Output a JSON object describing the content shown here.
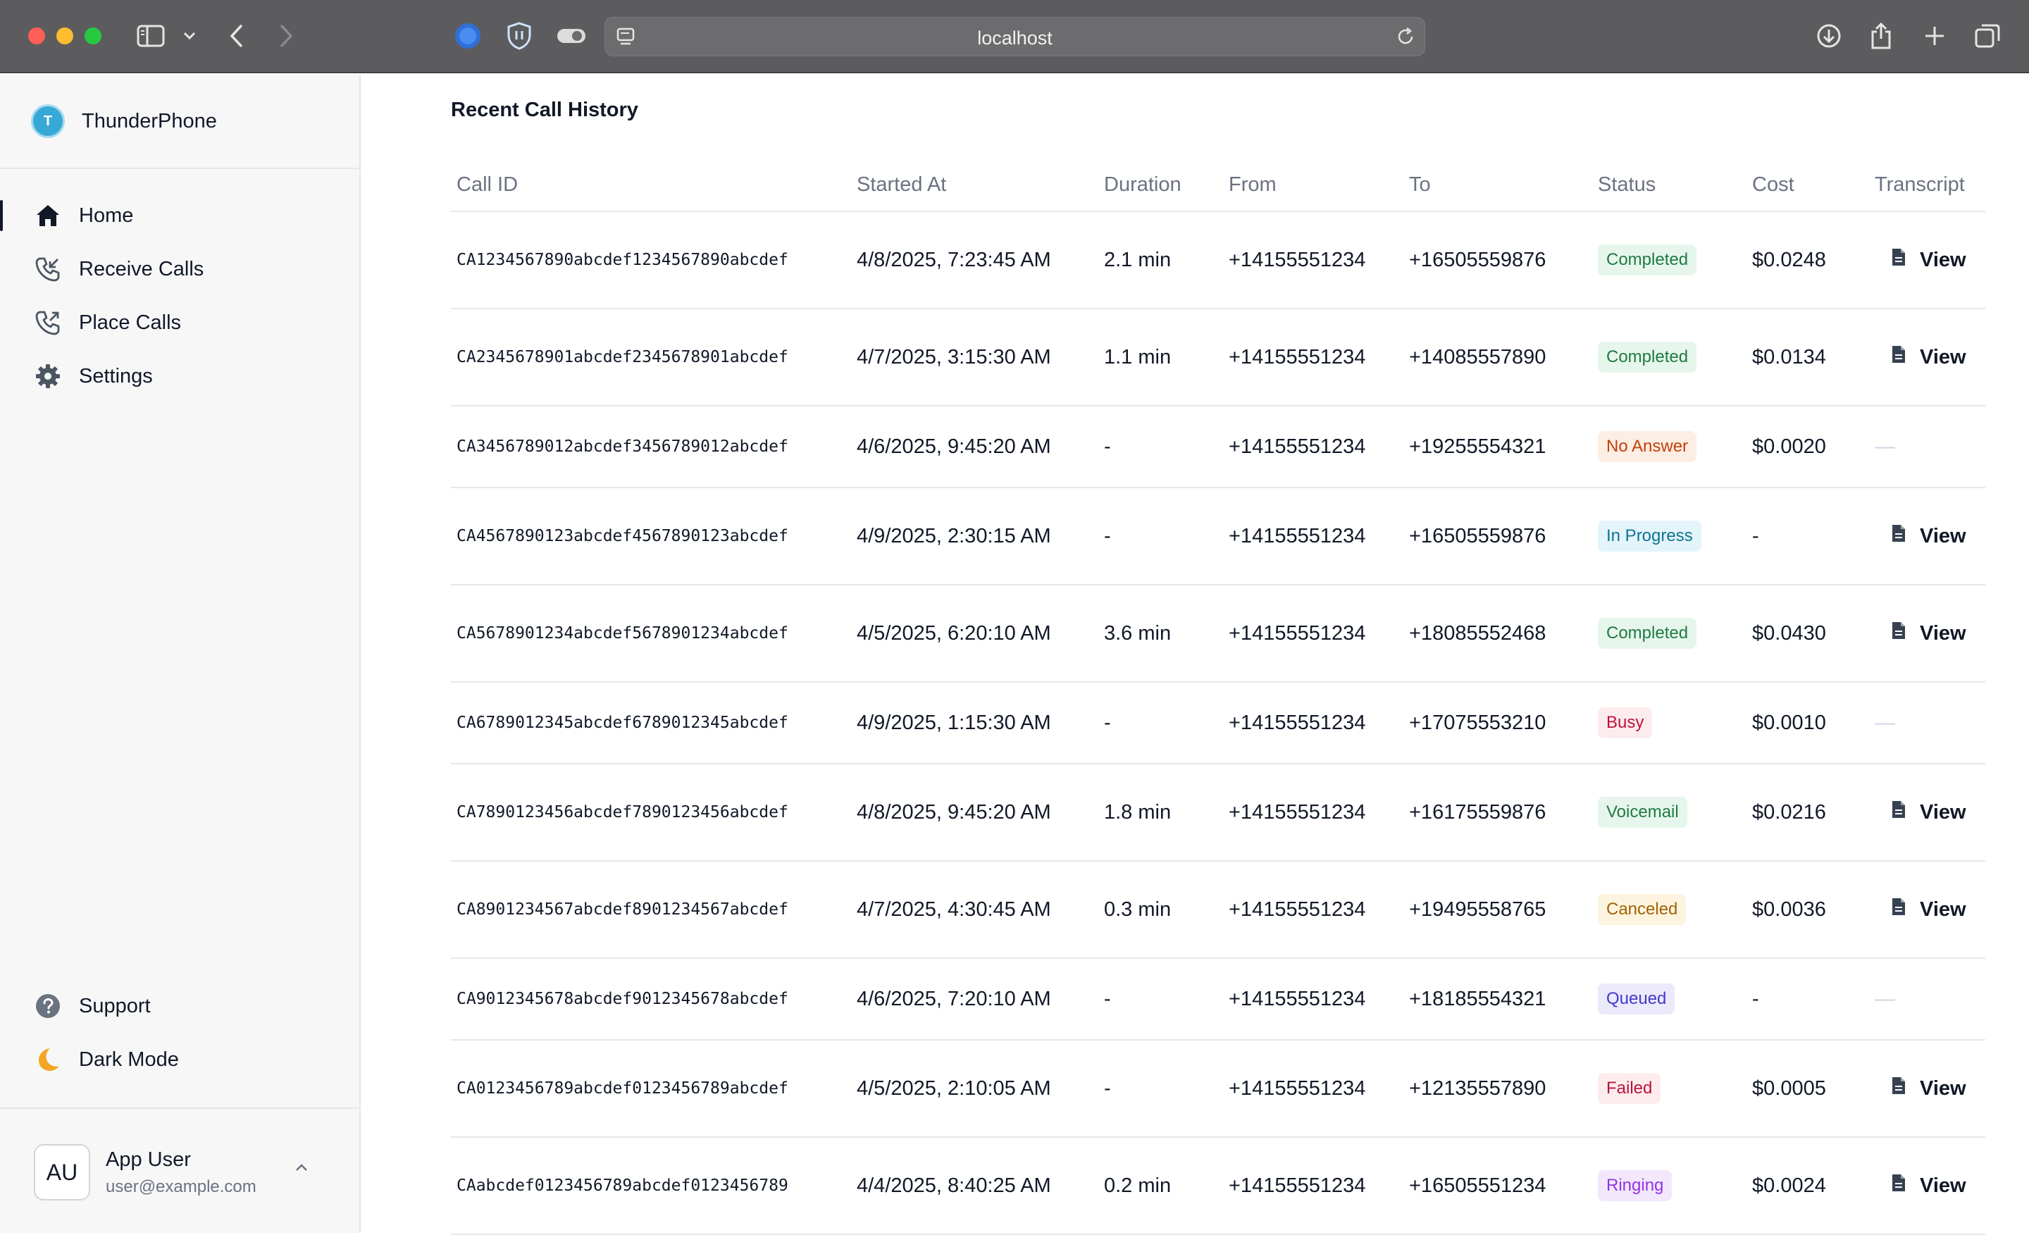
{
  "browser": {
    "url": "localhost"
  },
  "sidebar": {
    "brand": {
      "initial": "T",
      "name": "ThunderPhone"
    },
    "nav": [
      {
        "label": "Home",
        "icon": "home-icon",
        "active": true
      },
      {
        "label": "Receive Calls",
        "icon": "incoming-call-icon",
        "active": false
      },
      {
        "label": "Place Calls",
        "icon": "outgoing-call-icon",
        "active": false
      },
      {
        "label": "Settings",
        "icon": "gear-icon",
        "active": false
      }
    ],
    "bottom_nav": [
      {
        "label": "Support",
        "icon": "help-circle-icon"
      },
      {
        "label": "Dark Mode",
        "icon": "moon-icon"
      }
    ],
    "user": {
      "initials": "AU",
      "name": "App User",
      "email": "user@example.com"
    }
  },
  "main": {
    "title": "Recent Call History",
    "columns": [
      "Call ID",
      "Started At",
      "Duration",
      "From",
      "To",
      "Status",
      "Cost",
      "Transcript"
    ],
    "view_label": "View",
    "rows": [
      {
        "call_id": "CA1234567890abcdef1234567890abcdef",
        "started_at": "4/8/2025, 7:23:45 AM",
        "duration": "2.1 min",
        "from": "+14155551234",
        "to": "+16505559876",
        "status": "Completed",
        "cost": "$0.0248",
        "transcript": true
      },
      {
        "call_id": "CA2345678901abcdef2345678901abcdef",
        "started_at": "4/7/2025, 3:15:30 AM",
        "duration": "1.1 min",
        "from": "+14155551234",
        "to": "+14085557890",
        "status": "Completed",
        "cost": "$0.0134",
        "transcript": true
      },
      {
        "call_id": "CA3456789012abcdef3456789012abcdef",
        "started_at": "4/6/2025, 9:45:20 AM",
        "duration": "-",
        "from": "+14155551234",
        "to": "+19255554321",
        "status": "No Answer",
        "cost": "$0.0020",
        "transcript": false
      },
      {
        "call_id": "CA4567890123abcdef4567890123abcdef",
        "started_at": "4/9/2025, 2:30:15 AM",
        "duration": "-",
        "from": "+14155551234",
        "to": "+16505559876",
        "status": "In Progress",
        "cost": "-",
        "transcript": true
      },
      {
        "call_id": "CA5678901234abcdef5678901234abcdef",
        "started_at": "4/5/2025, 6:20:10 AM",
        "duration": "3.6 min",
        "from": "+14155551234",
        "to": "+18085552468",
        "status": "Completed",
        "cost": "$0.0430",
        "transcript": true
      },
      {
        "call_id": "CA6789012345abcdef6789012345abcdef",
        "started_at": "4/9/2025, 1:15:30 AM",
        "duration": "-",
        "from": "+14155551234",
        "to": "+17075553210",
        "status": "Busy",
        "cost": "$0.0010",
        "transcript": false
      },
      {
        "call_id": "CA7890123456abcdef7890123456abcdef",
        "started_at": "4/8/2025, 9:45:20 AM",
        "duration": "1.8 min",
        "from": "+14155551234",
        "to": "+16175559876",
        "status": "Voicemail",
        "cost": "$0.0216",
        "transcript": true
      },
      {
        "call_id": "CA8901234567abcdef8901234567abcdef",
        "started_at": "4/7/2025, 4:30:45 AM",
        "duration": "0.3 min",
        "from": "+14155551234",
        "to": "+19495558765",
        "status": "Canceled",
        "cost": "$0.0036",
        "transcript": true
      },
      {
        "call_id": "CA9012345678abcdef9012345678abcdef",
        "started_at": "4/6/2025, 7:20:10 AM",
        "duration": "-",
        "from": "+14155551234",
        "to": "+18185554321",
        "status": "Queued",
        "cost": "-",
        "transcript": false
      },
      {
        "call_id": "CA0123456789abcdef0123456789abcdef",
        "started_at": "4/5/2025, 2:10:05 AM",
        "duration": "-",
        "from": "+14155551234",
        "to": "+12135557890",
        "status": "Failed",
        "cost": "$0.0005",
        "transcript": true
      },
      {
        "call_id": "CAabcdef0123456789abcdef0123456789",
        "started_at": "4/4/2025, 8:40:25 AM",
        "duration": "0.2 min",
        "from": "+14155551234",
        "to": "+16505551234",
        "status": "Ringing",
        "cost": "$0.0024",
        "transcript": true
      }
    ]
  },
  "status_colors": {
    "Completed": {
      "bg": "#e7f6ec",
      "fg": "#1f7a45"
    },
    "No Answer": {
      "bg": "#fdeee3",
      "fg": "#c2410c"
    },
    "In Progress": {
      "bg": "#e4f4fb",
      "fg": "#0e7490"
    },
    "Busy": {
      "bg": "#fdecee",
      "fg": "#be123c"
    },
    "Voicemail": {
      "bg": "#e7f6ec",
      "fg": "#1f7a45"
    },
    "Canceled": {
      "bg": "#fdf4df",
      "fg": "#a16207"
    },
    "Queued": {
      "bg": "#ece9fb",
      "fg": "#4338ca"
    },
    "Failed": {
      "bg": "#fdecee",
      "fg": "#be123c"
    },
    "Ringing": {
      "bg": "#f3e8fb",
      "fg": "#9333ea"
    }
  }
}
